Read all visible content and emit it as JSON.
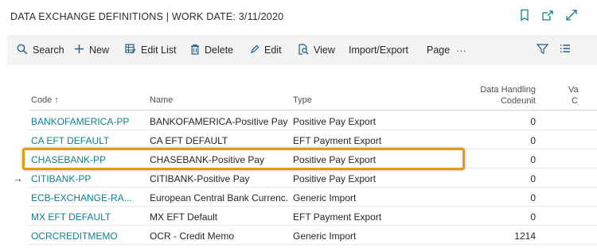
{
  "header": {
    "title": "DATA EXCHANGE DEFINITIONS | WORK DATE: 3/11/2020",
    "icons": [
      "bookmark-icon",
      "open-in-new-window-icon",
      "expand-icon"
    ]
  },
  "actions": {
    "search": "Search",
    "new": "New",
    "edit_list": "Edit List",
    "delete": "Delete",
    "edit": "Edit",
    "view": "View",
    "import_export": "Import/Export",
    "page": "Page",
    "more": "···"
  },
  "columns": {
    "code": "Code",
    "code_sort": "↑",
    "name": "Name",
    "type": "Type",
    "handling_line1": "Data Handling",
    "handling_line2": "Codeunit",
    "next_line1": "Va",
    "next_line2": "C"
  },
  "rows": [
    {
      "code": "BANKOFAMERICA-PP",
      "name": "BANKOFAMERICA-Positive Pay",
      "type": "Positive Pay Export",
      "handling": "0"
    },
    {
      "code": "CA EFT DEFAULT",
      "name": "CA EFT DEFAULT",
      "type": "EFT Payment Export",
      "handling": "0"
    },
    {
      "code": "CHASEBANK-PP",
      "name": "CHASEBANK-Positive Pay",
      "type": "Positive Pay Export",
      "handling": "0"
    },
    {
      "code": "CITIBANK-PP",
      "name": "CITIBANK-Positive Pay",
      "type": "Positive Pay Export",
      "handling": "0"
    },
    {
      "code": "ECB-EXCHANGE-RA...",
      "name": "European Central Bank Currenc...",
      "type": "Generic Import",
      "handling": "0"
    },
    {
      "code": "MX EFT DEFAULT",
      "name": "MX EFT Default",
      "type": "EFT Payment Export",
      "handling": "0"
    },
    {
      "code": "OCRCREDITMEMO",
      "name": "OCR - Credit Memo",
      "type": "Generic Import",
      "handling": "1214"
    }
  ],
  "row_pointer": "→",
  "highlighted_row": "CHASEBANK-PP",
  "colors": {
    "accent": "#0f7f8f",
    "highlight_border": "#e39b14",
    "action_bar_bg": "#f3f3f3"
  }
}
